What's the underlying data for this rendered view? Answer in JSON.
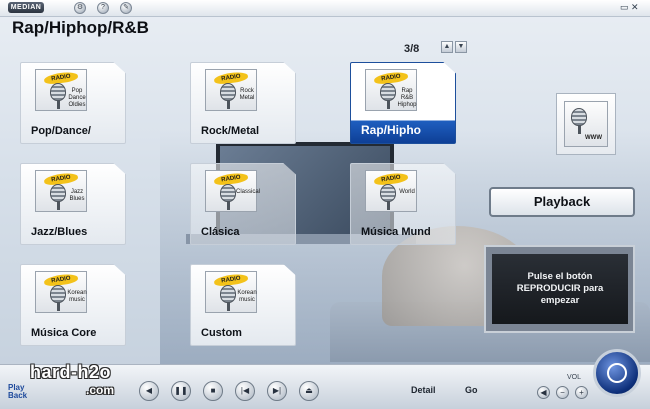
{
  "app": {
    "logo_text": "MEDIAN",
    "window_controls": "▭ ✕"
  },
  "page_title": "Rap/Hiphop/R&B",
  "pager": {
    "text": "3/8"
  },
  "tiles": [
    {
      "label": "Pop/Dance/",
      "genre": "Pop Dance Oldies",
      "state": "normal"
    },
    {
      "label": "Rock/Metal",
      "genre": "Rock Metal",
      "state": "normal"
    },
    {
      "label": "Rap/Hipho",
      "genre": "Rap R&B Hiphop",
      "state": "selected"
    },
    {
      "label": "Jazz/Blues",
      "genre": "Jazz Blues",
      "state": "normal"
    },
    {
      "label": "Clásica",
      "genre": "Classical",
      "state": "dim"
    },
    {
      "label": "Música Mund",
      "genre": "World",
      "state": "dim"
    },
    {
      "label": "Música Core",
      "genre": "Korean music",
      "state": "normal"
    },
    {
      "label": "Custom",
      "genre": "Korean music",
      "state": "normal"
    }
  ],
  "radio_badge": "RADIO",
  "www_tile": {
    "text": "WWW"
  },
  "playback_button": "Playback",
  "message": "Pulse el botón REPRODUCIR para empezar",
  "bottom": {
    "playback_logo_line1": "Play",
    "playback_logo_line2": "Back",
    "watermark": "hard-h2o",
    "watermark_sub": ".com",
    "detail_label": "Detail",
    "go_label": "Go",
    "vol_label": "VOL"
  },
  "colors": {
    "selected_tile": "#1f5fc0",
    "radio_badge": "#f3c21a"
  }
}
